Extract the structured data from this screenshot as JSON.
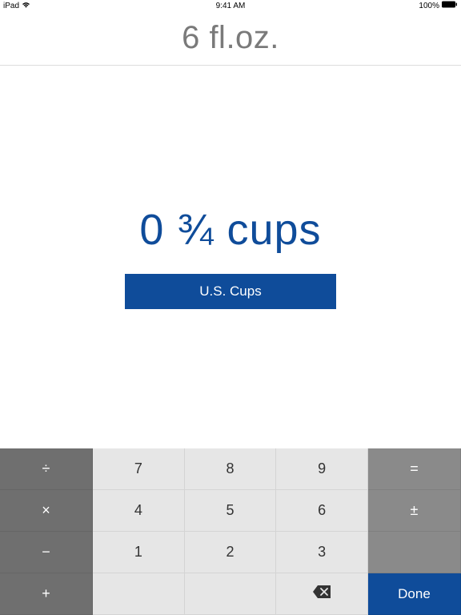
{
  "statusbar": {
    "device": "iPad",
    "time": "9:41 AM",
    "battery": "100%"
  },
  "top_display": "6 fl.oz.",
  "result_display": "0 ¾ cups",
  "unit_button_label": "U.S. Cups",
  "keypad": {
    "divide": "÷",
    "k7": "7",
    "k8": "8",
    "k9": "9",
    "equals": "=",
    "multiply": "×",
    "k4": "4",
    "k5": "5",
    "k6": "6",
    "plusminus": "±",
    "minus": "−",
    "k1": "1",
    "k2": "2",
    "k3": "3",
    "plus": "+",
    "done": "Done"
  },
  "colors": {
    "accent": "#0f4c9a",
    "op_dark": "#6f6f6f",
    "op_light": "#8a8a8a",
    "num_bg": "#e6e6e6"
  }
}
